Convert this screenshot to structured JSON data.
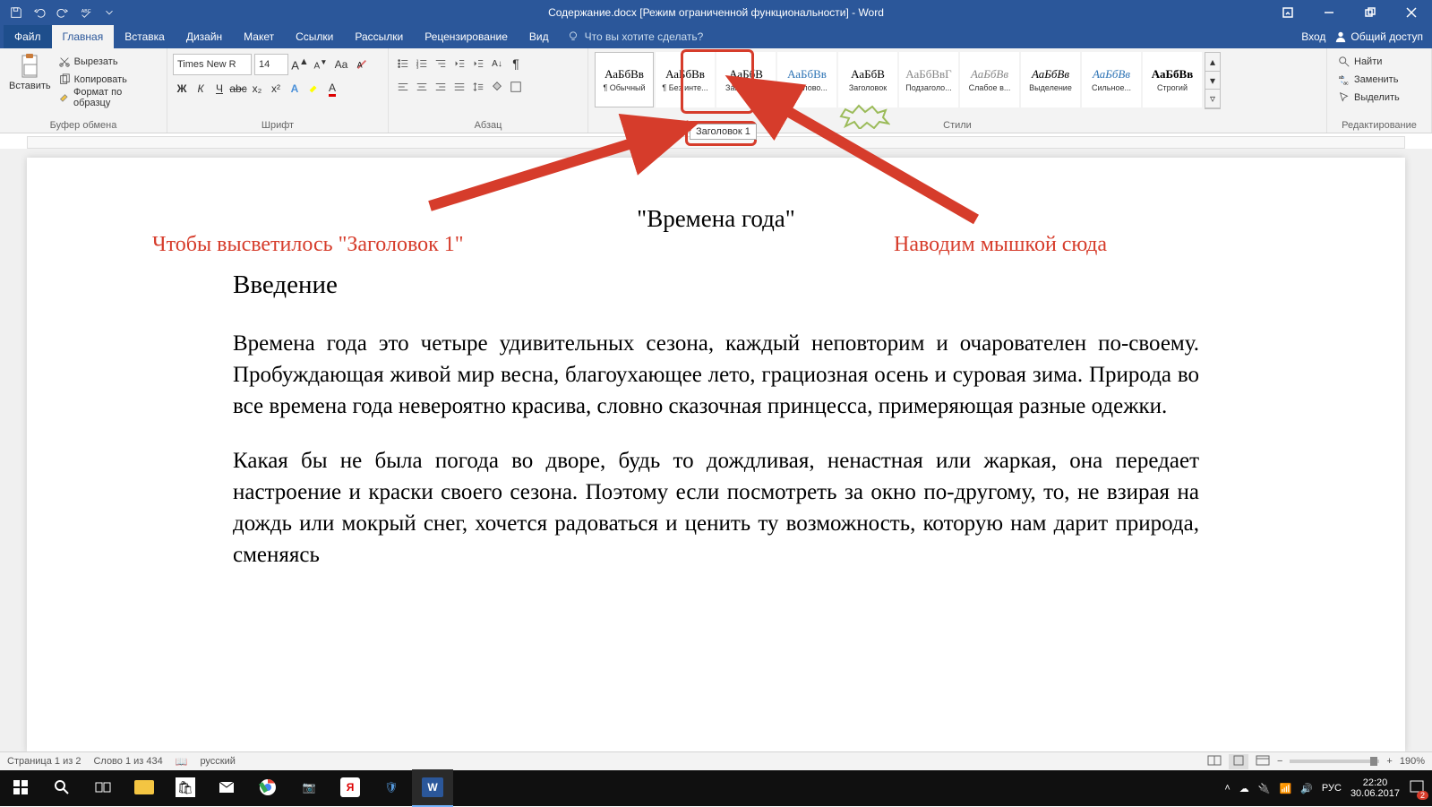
{
  "titlebar": {
    "title": "Содержание.docx [Режим ограниченной функциональности] - Word"
  },
  "menutabs": {
    "file": "Файл",
    "home": "Главная",
    "insert": "Вставка",
    "design": "Дизайн",
    "layout": "Макет",
    "references": "Ссылки",
    "mailings": "Рассылки",
    "review": "Рецензирование",
    "view": "Вид"
  },
  "tellme": "Что вы хотите сделать?",
  "rightmenu": {
    "signin": "Вход",
    "share": "Общий доступ"
  },
  "ribbon": {
    "clipboard": {
      "paste": "Вставить",
      "cut": "Вырезать",
      "copy": "Копировать",
      "format_painter": "Формат по образцу",
      "label": "Буфер обмена"
    },
    "font": {
      "name": "Times New R",
      "size": "14",
      "label": "Шрифт",
      "bold": "Ж",
      "italic": "К",
      "underline": "Ч",
      "strike": "abc",
      "sub": "x₂",
      "sup": "x²"
    },
    "paragraph": {
      "label": "Абзац"
    },
    "styles": {
      "label": "Стили",
      "items": [
        {
          "preview": "АаБбВв",
          "name": "¶ Обычный",
          "sel": true,
          "color": "#000"
        },
        {
          "preview": "АаБбВв",
          "name": "¶ Без инте...",
          "sel": false,
          "color": "#000"
        },
        {
          "preview": "АаБбВ",
          "name": "Заголово...",
          "sel": false,
          "color": "#000"
        },
        {
          "preview": "АаБбВв",
          "name": "Заголово...",
          "sel": false,
          "color": "#2e74b5"
        },
        {
          "preview": "АаБбВ",
          "name": "Заголовок",
          "sel": false,
          "color": "#000"
        },
        {
          "preview": "АаБбВвГ",
          "name": "Подзаголо...",
          "sel": false,
          "color": "#888"
        },
        {
          "preview": "АаБбВв",
          "name": "Слабое в...",
          "sel": false,
          "color": "#888",
          "it": true
        },
        {
          "preview": "АаБбВв",
          "name": "Выделение",
          "sel": false,
          "color": "#000",
          "it": true
        },
        {
          "preview": "АаБбВв",
          "name": "Сильное...",
          "sel": false,
          "color": "#2e74b5",
          "it": true
        },
        {
          "preview": "АаБбВв",
          "name": "Строгий",
          "sel": false,
          "color": "#000",
          "bold": true
        }
      ]
    },
    "editing": {
      "find": "Найти",
      "replace": "Заменить",
      "select": "Выделить",
      "label": "Редактирование"
    }
  },
  "tooltip": "Заголовок 1",
  "annotations": {
    "left": "Чтобы высветилось \"Заголовок 1\"",
    "right": "Наводим мышкой сюда"
  },
  "document": {
    "title": "\"Времена года\"",
    "h1": "Введение",
    "p1": "Времена года это четыре удивительных сезона, каждый неповторим и очарователен по-своему. Пробуждающая живой мир весна, благоухающее лето, грациозная осень и суровая зима. Природа во все времена года невероятно красива, словно сказочная принцесса, примеряющая разные одежки.",
    "p2": "Какая бы не была погода во дворе, будь то дождливая, ненастная или жаркая, она передает настроение и краски своего сезона. Поэтому если посмотреть за окно по-другому, то, не взирая на дождь или мокрый снег, хочется радоваться и ценить ту возможность, которую нам дарит природа, сменяясь"
  },
  "statusbar": {
    "page": "Страница 1 из 2",
    "words": "Слово 1 из 434",
    "lang": "русский",
    "zoom": "190%"
  },
  "taskbar": {
    "lang": "РУС",
    "time": "22:20",
    "date": "30.06.2017",
    "notif": "2"
  }
}
